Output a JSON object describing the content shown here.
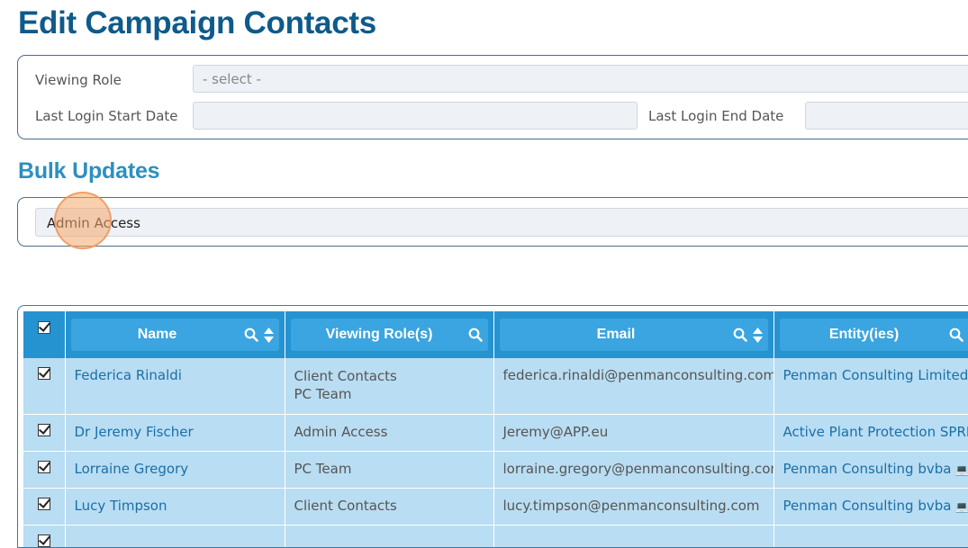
{
  "page": {
    "title": "Edit Campaign Contacts"
  },
  "filters": {
    "viewing_role_label": "Viewing Role",
    "viewing_role_placeholder": "- select -",
    "login_start_label": "Last Login Start Date",
    "login_start_value": "",
    "login_end_label": "Last Login End Date",
    "login_end_value": ""
  },
  "bulk": {
    "title": "Bulk Updates",
    "selected_value": "Admin Access"
  },
  "table": {
    "columns": [
      {
        "label": "Name"
      },
      {
        "label": "Viewing Role(s)"
      },
      {
        "label": "Email"
      },
      {
        "label": "Entity(ies)"
      }
    ],
    "rows": [
      {
        "name": "Federica Rinaldi",
        "roles": [
          "Client Contacts",
          "PC Team"
        ],
        "email": "federica.rinaldi@penmanconsulting.com",
        "entity": "Penman Consulting Limited"
      },
      {
        "name": "Dr Jeremy Fischer",
        "roles": [
          "Admin Access"
        ],
        "email": "Jeremy@APP.eu",
        "entity": "Active Plant Protection SPRL"
      },
      {
        "name": "Lorraine Gregory",
        "roles": [
          "PC Team"
        ],
        "email": "lorraine.gregory@penmanconsulting.com",
        "entity": "Penman Consulting bvba"
      },
      {
        "name": "Lucy Timpson",
        "roles": [
          "Client Contacts"
        ],
        "email": "lucy.timpson@penmanconsulting.com",
        "entity": "Penman Consulting bvba"
      }
    ]
  }
}
